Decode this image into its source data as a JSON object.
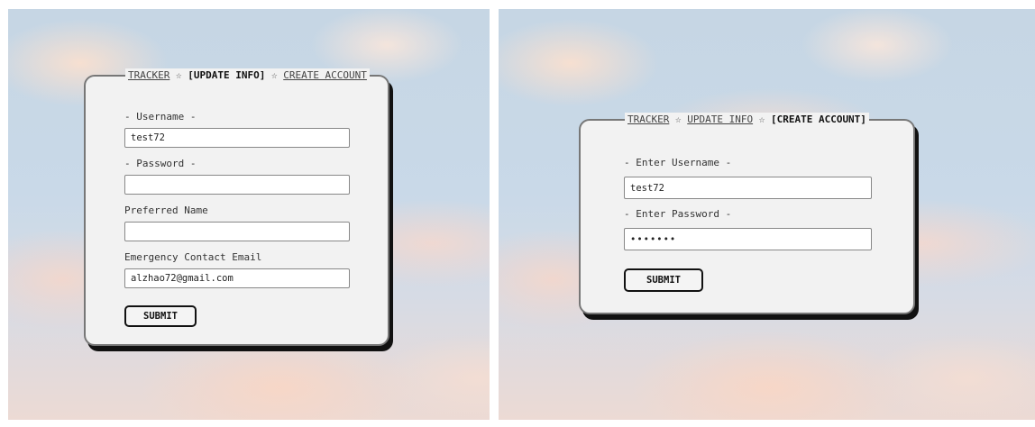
{
  "left": {
    "nav": {
      "tracker": "TRACKER",
      "star1": "☆",
      "update_info": "[UPDATE INFO]",
      "star2": "☆",
      "create_account": "CREATE ACCOUNT"
    },
    "username_label": "- Username -",
    "username_value": "test72",
    "password_label": "- Password -",
    "password_value": "",
    "preferred_name_label": "Preferred Name",
    "preferred_name_value": "",
    "emergency_email_label": "Emergency Contact Email",
    "emergency_email_value": "alzhao72@gmail.com",
    "submit_label": "SUBMIT"
  },
  "right": {
    "nav": {
      "tracker": "TRACKER",
      "star1": "☆",
      "update_info": "UPDATE INFO",
      "star2": "☆",
      "create_account": "[CREATE ACCOUNT]"
    },
    "username_label": "- Enter Username -",
    "username_value": "test72",
    "password_label": "- Enter Password -",
    "password_value": "•••••••",
    "submit_label": "SUBMIT"
  }
}
